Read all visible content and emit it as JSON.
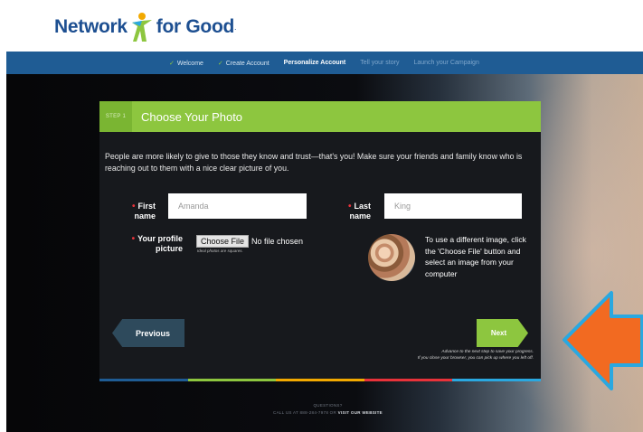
{
  "brand": {
    "logo_left": "Network",
    "logo_right": "for Good",
    "logo_mark": "."
  },
  "nav": {
    "steps": [
      {
        "label": "Welcome",
        "state": "done"
      },
      {
        "label": "Create Account",
        "state": "done"
      },
      {
        "label": "Personalize Account",
        "state": "active"
      },
      {
        "label": "Tell your story",
        "state": "future"
      },
      {
        "label": "Launch your Campaign",
        "state": "future"
      }
    ]
  },
  "panel": {
    "step_badge": "STEP 1",
    "title": "Choose Your Photo",
    "intro": "People are more likely to give to those they know and trust—that's you! Make sure your friends and family know who is reaching out to them with a nice clear picture of you.",
    "first_name": {
      "label_1": "First",
      "label_2": "name",
      "value": "Amanda"
    },
    "last_name": {
      "label_1": "Last",
      "label_2": "name",
      "value": "King"
    },
    "profile_picture": {
      "label_1": "Your profile",
      "label_2": "picture",
      "button": "Choose File",
      "status": "No file chosen",
      "hint": "Ideal photos are squares."
    },
    "avatar_note": "To use a different image, click the 'Choose File' button and select an image from your computer",
    "previous_button": "Previous",
    "next_button": "Next",
    "advance_line_1": "Advance to the next step to save your progress.",
    "advance_line_2": "If you close your browser, you can pick up where you left off."
  },
  "footer": {
    "line_1": "QUESTIONS?",
    "line_2": "CALL US AT 888-284-7978 OR",
    "link": "VISIT OUR WEBSITE"
  },
  "colors": {
    "nav_blue": "#1f5c94",
    "brand_green": "#8dc63f",
    "required_red": "#e8323a",
    "arrow_orange": "#f26a21",
    "arrow_outline": "#2aa8e0",
    "stripe": [
      "#1f5c94",
      "#8dc63f",
      "#f2a900",
      "#e8323a",
      "#2aa8e0"
    ]
  },
  "icons": [
    "logo-figure-icon",
    "check-icon",
    "required-asterisk-icon",
    "arrow-left-icon",
    "arrow-right-icon",
    "annotation-arrow-icon"
  ]
}
